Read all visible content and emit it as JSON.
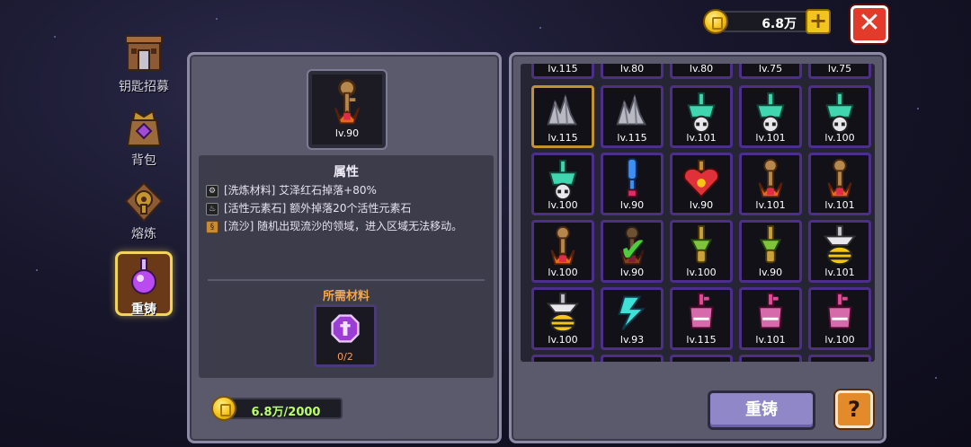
{
  "nav": {
    "items": [
      {
        "label": "钥匙招募",
        "icon": "tower-icon"
      },
      {
        "label": "背包",
        "icon": "backpack-icon"
      },
      {
        "label": "熔炼",
        "icon": "forge-icon"
      },
      {
        "label": "重铸",
        "icon": "potion-reforge-icon"
      }
    ],
    "active": "重铸"
  },
  "currency": {
    "coins_label": "6.8万",
    "plus_label": "+",
    "close_label": "✕"
  },
  "detail": {
    "item_level": "lv.90",
    "attr_title": "属性",
    "attributes": [
      {
        "icon": "gear-icon",
        "text": "[洗炼材料] 艾泽红石掉落+80%"
      },
      {
        "icon": "flame-icon",
        "text": "[活性元素石] 额外掉落20个活性元素石"
      },
      {
        "icon": "sand-icon",
        "text": "[流沙] 随机出现流沙的领域，进入区域无法移动。"
      }
    ],
    "materials_title": "所需材料",
    "material_count": "0/2",
    "cost_label": "6.8万/2000"
  },
  "grid": {
    "top_partial_levels": [
      "lv.115",
      "lv.80",
      "lv.80",
      "lv.75",
      "lv.75"
    ],
    "items": [
      {
        "level": "lv.115",
        "kind": "crystal",
        "selected": true
      },
      {
        "level": "lv.115",
        "kind": "crystal"
      },
      {
        "level": "lv.101",
        "kind": "teal-skull"
      },
      {
        "level": "lv.101",
        "kind": "teal-skull"
      },
      {
        "level": "lv.100",
        "kind": "teal-skull"
      },
      {
        "level": "lv.100",
        "kind": "teal-skull"
      },
      {
        "level": "lv.90",
        "kind": "blue-key"
      },
      {
        "level": "lv.90",
        "kind": "heart"
      },
      {
        "level": "lv.101",
        "kind": "bronze-key"
      },
      {
        "level": "lv.101",
        "kind": "bronze-key"
      },
      {
        "level": "lv.100",
        "kind": "bronze-key"
      },
      {
        "level": "lv.90",
        "kind": "bronze-key",
        "checked": true
      },
      {
        "level": "lv.100",
        "kind": "green-key"
      },
      {
        "level": "lv.90",
        "kind": "green-key"
      },
      {
        "level": "lv.101",
        "kind": "bee"
      },
      {
        "level": "lv.100",
        "kind": "bee"
      },
      {
        "level": "lv.93",
        "kind": "cyan-bolt"
      },
      {
        "level": "lv.115",
        "kind": "pink-key"
      },
      {
        "level": "lv.101",
        "kind": "pink-key"
      },
      {
        "level": "lv.100",
        "kind": "pink-key"
      }
    ]
  },
  "actions": {
    "reforge_label": "重铸",
    "help_label": "?"
  },
  "colors": {
    "accent_gold": "#f2c51e",
    "close_red": "#e23b2b",
    "panel": "#5b5a6c",
    "slot_border": "#4d2f8a",
    "cost_green": "#b9ff6a",
    "materials_orange": "#f0a84a"
  }
}
